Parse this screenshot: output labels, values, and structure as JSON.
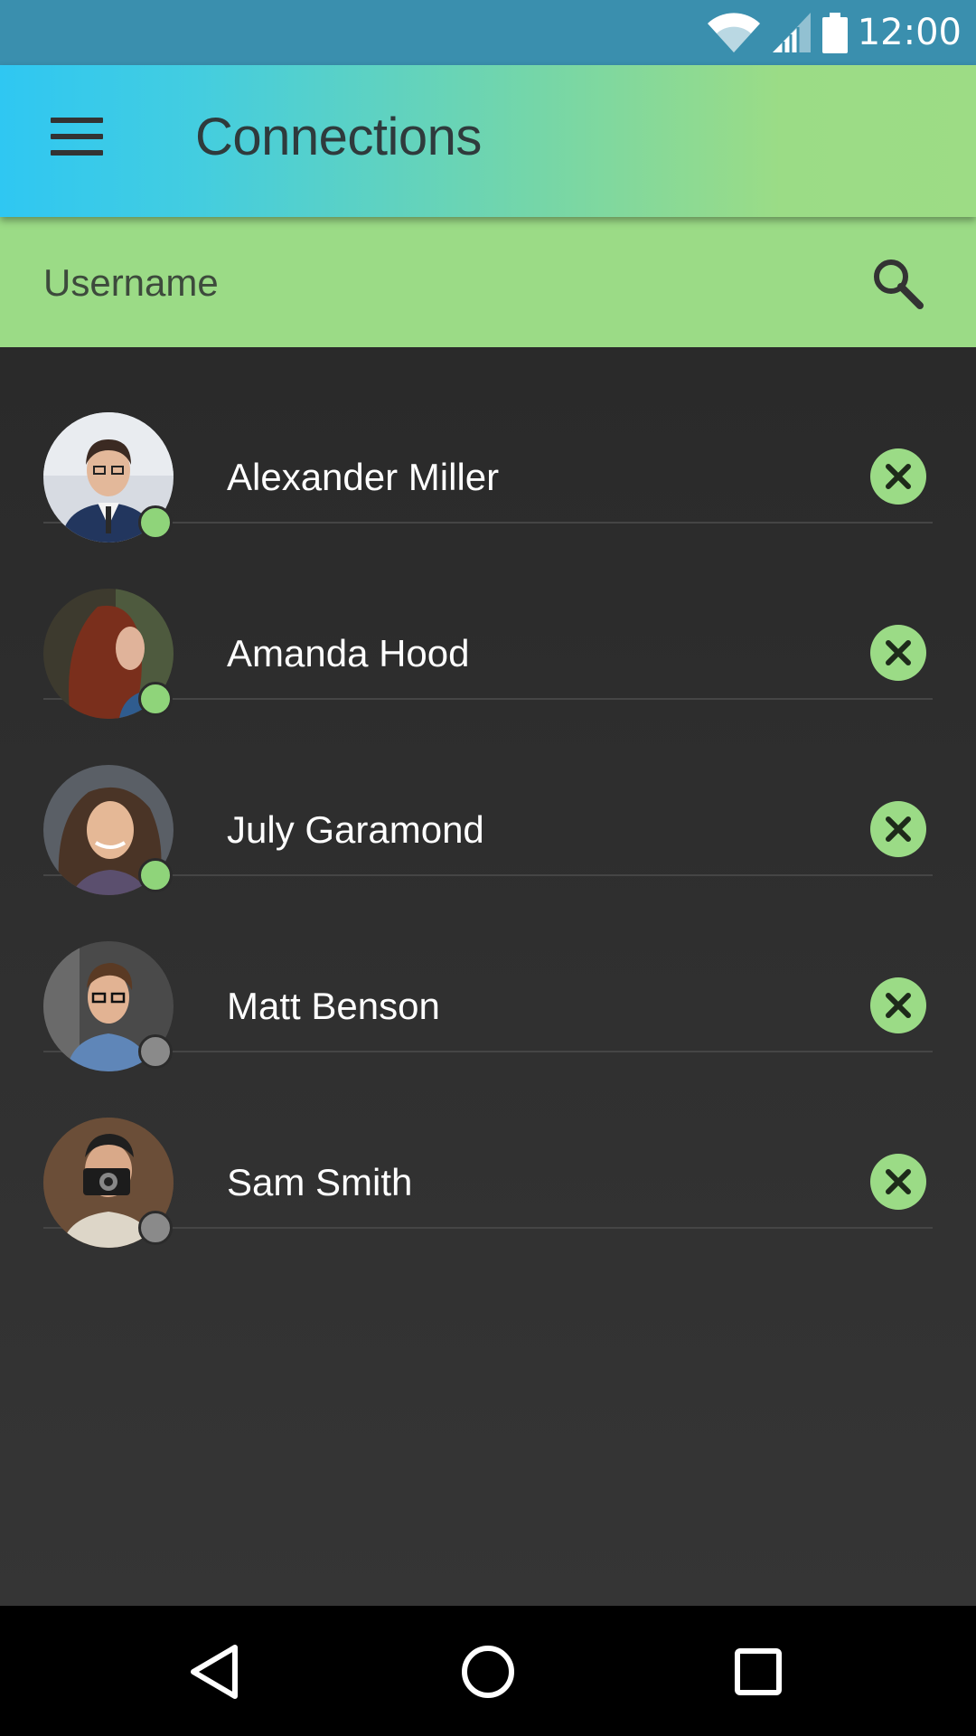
{
  "status_bar": {
    "time": "12:00",
    "icons": [
      "wifi-icon",
      "cell-signal-icon",
      "battery-icon"
    ],
    "color": "#3a8fae"
  },
  "app_bar": {
    "title": "Connections",
    "menu_icon": "hamburger-menu-icon",
    "gradient": [
      "#2fc7f2",
      "#9ddc85"
    ]
  },
  "search": {
    "placeholder": "Username",
    "value": "",
    "icon": "search-icon",
    "background": "#9bdb86"
  },
  "connections": [
    {
      "name": "Alexander Miller",
      "status": "online"
    },
    {
      "name": "Amanda Hood",
      "status": "online"
    },
    {
      "name": "July Garamond",
      "status": "online"
    },
    {
      "name": "Matt Benson",
      "status": "offline"
    },
    {
      "name": "Sam Smith",
      "status": "offline"
    }
  ],
  "colors": {
    "online": "#8fd47a",
    "offline": "#8a8a8a",
    "accent": "#9bdb86",
    "list_background": "#2b2b2b"
  },
  "nav_bar": {
    "icons": [
      "back-icon",
      "home-icon",
      "recents-icon"
    ]
  }
}
